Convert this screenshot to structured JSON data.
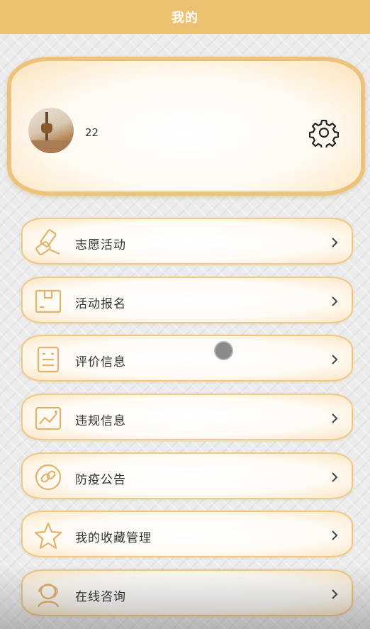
{
  "header": {
    "title": "我的"
  },
  "profile": {
    "username": "22",
    "avatar_icon": "avatar-photo",
    "settings_icon": "gear-icon"
  },
  "menu": {
    "items": [
      {
        "label": "志愿活动",
        "icon": "roller-icon"
      },
      {
        "label": "活动报名",
        "icon": "box-icon"
      },
      {
        "label": "评价信息",
        "icon": "clipboard-icon"
      },
      {
        "label": "违规信息",
        "icon": "chart-icon"
      },
      {
        "label": "防疫公告",
        "icon": "link-icon"
      },
      {
        "label": "我的收藏管理",
        "icon": "star-icon"
      },
      {
        "label": "在线咨询",
        "icon": "support-icon"
      }
    ]
  },
  "colors": {
    "accent": "#ecc16f",
    "border": "#f0c987",
    "icon_stroke": "#e2b36a"
  }
}
